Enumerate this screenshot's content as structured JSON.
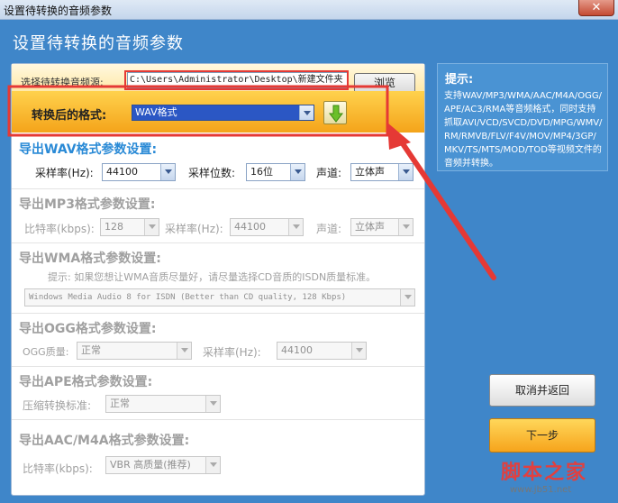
{
  "window": {
    "title": "设置待转换的音频参数",
    "close_label": "✕"
  },
  "header": {
    "title": "设置待转换的音频参数"
  },
  "source": {
    "label": "选择待转换音频源:",
    "path": "C:\\Users\\Administrator\\Desktop\\新建文件夹",
    "browse_label": "浏览"
  },
  "format": {
    "label": "转换后的格式:",
    "selected": "WAV格式"
  },
  "wav": {
    "title": "导出WAV格式参数设置:",
    "sample_rate_label": "采样率(Hz):",
    "sample_rate": "44100",
    "bits_label": "采样位数:",
    "bits": "16位",
    "channel_label": "声道:",
    "channel": "立体声"
  },
  "mp3": {
    "title": "导出MP3格式参数设置:",
    "bitrate_label": "比特率(kbps):",
    "bitrate": "128",
    "sample_rate_label": "采样率(Hz):",
    "sample_rate": "44100",
    "channel_label": "声道:",
    "channel": "立体声"
  },
  "wma": {
    "title": "导出WMA格式参数设置:",
    "hint": "提示: 如果您想让WMA音质尽量好，请尽量选择CD音质的ISDN质量标准。",
    "quality": "Windows Media Audio 8 for ISDN (Better than CD quality, 128 Kbps)"
  },
  "ogg": {
    "title": "导出OGG格式参数设置:",
    "quality_label": "OGG质量:",
    "quality": "正常",
    "sample_rate_label": "采样率(Hz):",
    "sample_rate": "44100"
  },
  "ape": {
    "title": "导出APE格式参数设置:",
    "level_label": "压缩转换标准:",
    "level": "正常"
  },
  "aac": {
    "title": "导出AAC/M4A格式参数设置:",
    "bitrate_label": "比特率(kbps):",
    "bitrate": "VBR 高质量(推荐)"
  },
  "tips": {
    "title": "提示:",
    "body": "支持WAV/MP3/WMA/AAC/M4A/OGG/APE/AC3/RMA等音频格式，同时支持抓取AVI/VCD/SVCD/DVD/MPG/WMV/RM/RMVB/FLV/F4V/MOV/MP4/3GP/MKV/TS/MTS/MOD/TOD等视频文件的音频并转换。"
  },
  "buttons": {
    "cancel": "取消并返回",
    "next": "下一步"
  },
  "watermark": {
    "text": "脚本之家",
    "url": "www.jb51.net"
  },
  "colors": {
    "accent": "#2a8ad6",
    "highlight": "#e53935",
    "window_bg": "#3f86c9"
  }
}
